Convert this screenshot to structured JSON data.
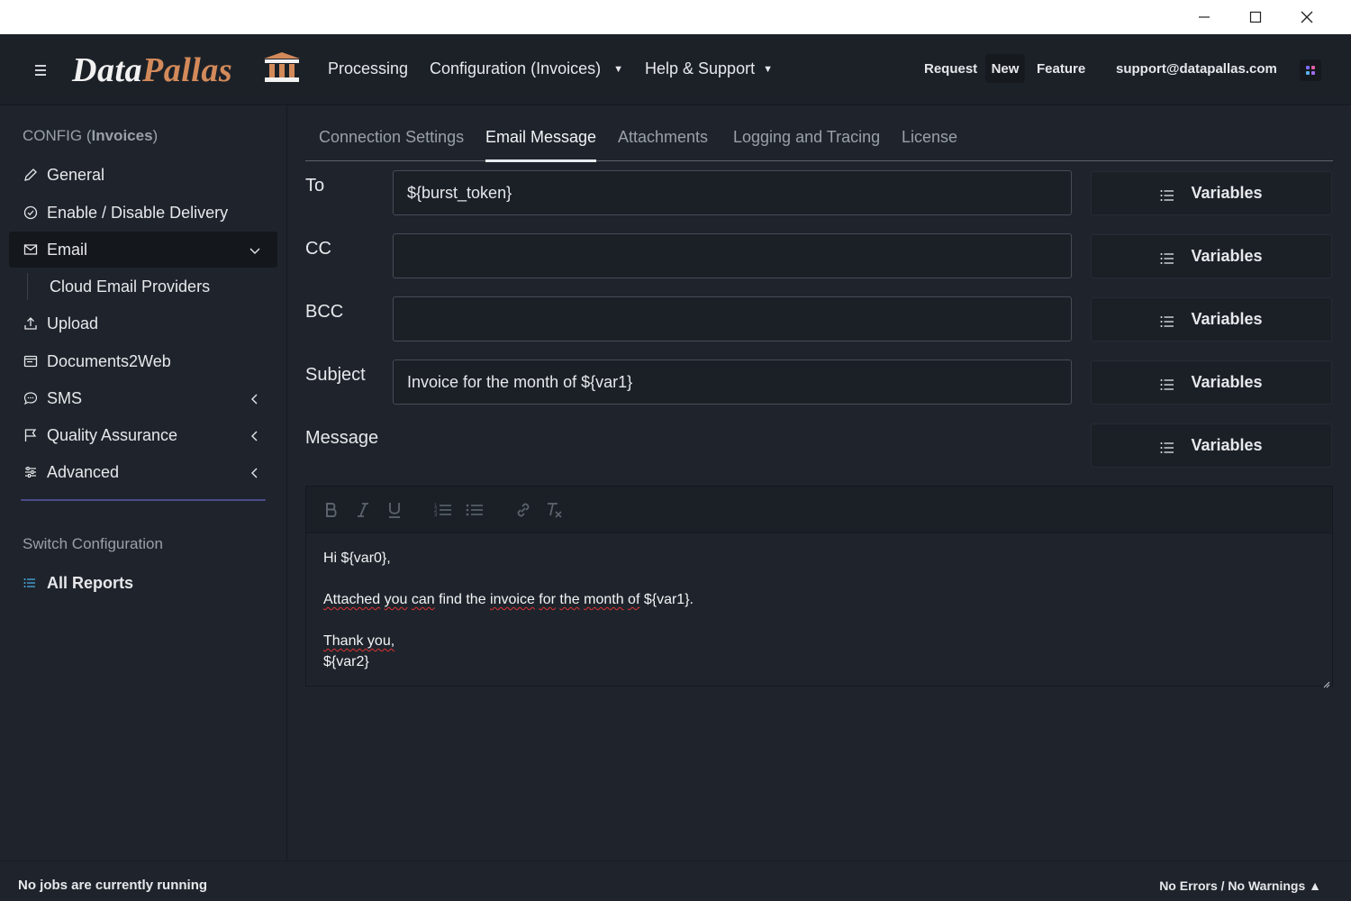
{
  "window": {
    "minimize_icon": "minimize-icon",
    "maximize_icon": "maximize-icon",
    "close_icon": "close-icon"
  },
  "header": {
    "logo_part1": "Data",
    "logo_part2": "Pallas",
    "nav": [
      {
        "label": "Processing"
      },
      {
        "label": "Configuration (Invoices)"
      },
      {
        "label": "Help & Support"
      }
    ],
    "request_label": "Request",
    "new_label": "New",
    "feature_label": "Feature",
    "support_email": "support@datapallas.com"
  },
  "sidebar": {
    "title_prefix": "CONFIG (",
    "title_bold": "Invoices",
    "title_suffix": ")",
    "items": [
      {
        "label": "General",
        "icon": "pencil-icon"
      },
      {
        "label": "Enable / Disable Delivery",
        "icon": "check-circle-icon"
      },
      {
        "label": "Email",
        "icon": "envelope-icon"
      },
      {
        "label": "Upload",
        "icon": "upload-icon"
      },
      {
        "label": "Documents2Web",
        "icon": "browser-window-icon"
      },
      {
        "label": "SMS",
        "icon": "chat-bubble-icon"
      },
      {
        "label": "Quality Assurance",
        "icon": "flag-icon"
      },
      {
        "label": "Advanced",
        "icon": "sliders-icon"
      }
    ],
    "email_sub": "Cloud Email Providers",
    "switch_config": "Switch Configuration",
    "all_reports": "All Reports"
  },
  "tabs": [
    {
      "label": "Connection Settings"
    },
    {
      "label": "Email Message"
    },
    {
      "label": "Attachments"
    },
    {
      "label": "Logging and Tracing"
    },
    {
      "label": "License"
    }
  ],
  "form": {
    "to_label": "To",
    "to_value": "${burst_token}",
    "cc_label": "CC",
    "cc_value": "",
    "bcc_label": "BCC",
    "bcc_value": "",
    "subject_label": "Subject",
    "subject_value": "Invoice for the month of ${var1}",
    "message_label": "Message",
    "variables_label": "Variables"
  },
  "editor": {
    "line1": "Hi ${var0},",
    "line2_a": "Attached",
    "line2_b": " ",
    "line2_c": "you",
    "line2_d": " ",
    "line2_e": "can",
    "line2_f": " find the ",
    "line2_g": "invoice",
    "line2_h": " ",
    "line2_i": "for",
    "line2_j": " ",
    "line2_k": "the",
    "line2_l": " ",
    "line2_m": "month",
    "line2_n": " ",
    "line2_o": "of",
    "line2_p": " ${var1}.",
    "line3": "Thank you,",
    "line4": "${var2}"
  },
  "status": {
    "left": "No jobs are currently running",
    "right": "No Errors / No Warnings ▲"
  },
  "colors": {
    "logo_accent": "#d38a5a",
    "active_tab_underline": "#e9ecef",
    "spell_error": "#dd3333"
  }
}
